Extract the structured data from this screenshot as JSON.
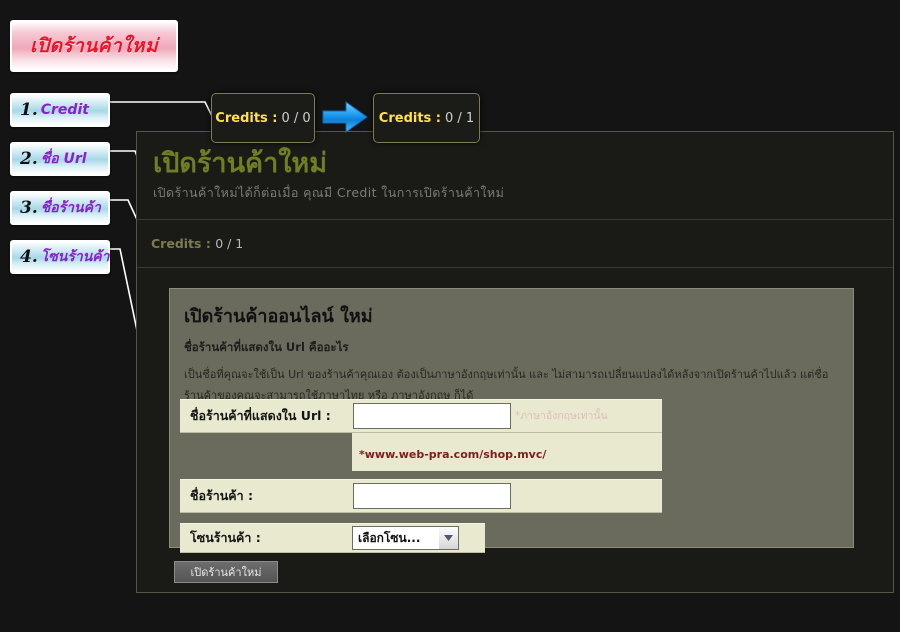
{
  "page": {
    "background_color": "#141414"
  },
  "annotations": {
    "title_badge": {
      "text": "เปิดร้านค้าใหม่",
      "text_color": "#e8152a",
      "bg_color": "#efa8ba"
    },
    "steps": [
      {
        "number": "1.",
        "label": "Credit"
      },
      {
        "number": "2.",
        "label": "ชื่อ Url"
      },
      {
        "number": "3.",
        "label": "ชื่อร้านค้า"
      },
      {
        "number": "4.",
        "label": "โซนร้านค้า"
      }
    ],
    "step_label_color": "#8a20c9",
    "step_bg_color": "#a7d8e8",
    "connector_color": "#ffffff"
  },
  "credit_badges": {
    "before": {
      "key": "Credits :",
      "value": "0 / 0"
    },
    "after": {
      "key": "Credits :",
      "value": "0 / 1"
    },
    "key_color": "#ffe24a",
    "border_color": "#7e7c52",
    "arrow_icon": "right-arrow-icon",
    "arrow_color": "#1f9ff0"
  },
  "main_panel": {
    "title": "เปิดร้านค้าใหม่",
    "title_color": "#6f7f23",
    "subtitle": "เปิดร้านค้าใหม่ได้ก็ต่อเมื่อ คุณมี Credit ในการเปิดร้านค้าใหม่",
    "credits_label": "Credits :",
    "credits_value": "0 / 1",
    "border_color": "#575740"
  },
  "form_card": {
    "title": "เปิดร้านค้าออนไลน์ ใหม่",
    "subtitle": "ชื่อร้านค้าที่แสดงใน Url คืออะไร",
    "paragraph": "เป็นชื่อที่คุณจะใช้เป็น Url ของร้านค้าคุณเอง ต้องเป็นภาษาอังกฤษเท่านั้น และ ไม่สามารถเปลี่ยนแปลงได้หลังจากเปิดร้านค้าไปแล้ว แต่ชื่อร้านค้าของคุณจะสามารถใช้ภาษาไทย หรือ ภาษาอังกฤษ ก็ได้",
    "bg_color": "#6b6b5d",
    "row_bg_color": "#e9e9cf",
    "fields": {
      "url_name": {
        "label": "ชื่อร้านค้าที่แสดงใน Url :",
        "value": "",
        "requirement_note": "*ภาษาอังกฤษเท่านั้น",
        "url_hint": "*www.web-pra.com/shop.mvc/",
        "url_hint_color": "#7a2020"
      },
      "shop_name": {
        "label": "ชื่อร้านค้า :",
        "value": ""
      },
      "shop_zone": {
        "label": "โซนร้านค้า :",
        "selected_option": "เลือกโซน...",
        "dropdown_icon": "chevron-down-icon"
      }
    },
    "submit_label": "เปิดร้านค้าใหม่"
  }
}
